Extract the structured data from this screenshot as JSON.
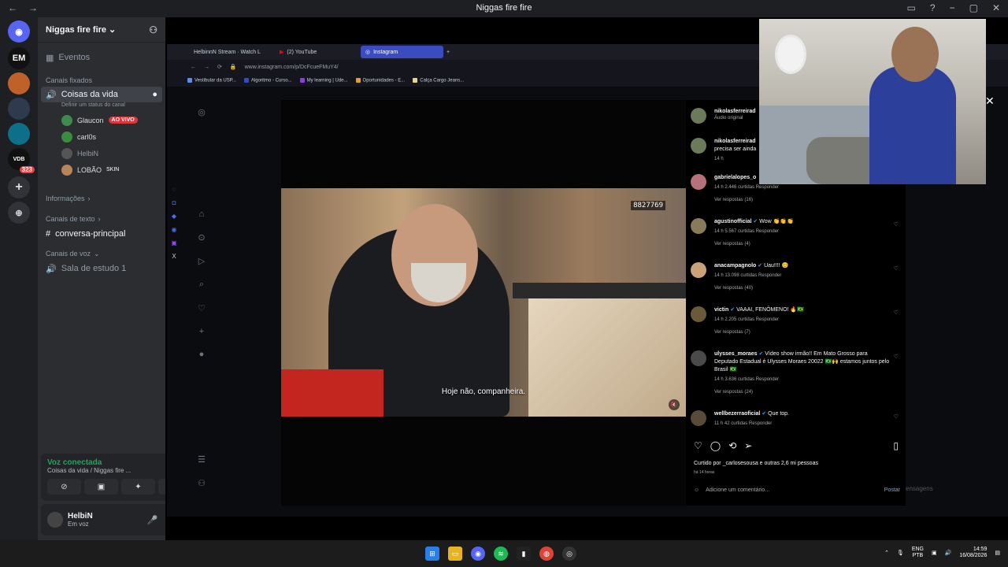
{
  "window": {
    "title": "Niggas fire fire",
    "controls": [
      "−",
      "▢",
      "✕"
    ]
  },
  "servers": [
    {
      "name": "discord-home",
      "label": ""
    },
    {
      "name": "server-em",
      "label": "EM"
    },
    {
      "name": "server-tiger",
      "label": ""
    },
    {
      "name": "server-selected",
      "label": ""
    },
    {
      "name": "server-blue",
      "label": ""
    },
    {
      "name": "server-vdb",
      "label": "VDB",
      "badge": "323"
    },
    {
      "name": "add-server",
      "label": "+"
    },
    {
      "name": "explore",
      "label": "⊕"
    }
  ],
  "guild": {
    "name": "Niggas fire fire",
    "events": "Eventos",
    "pinned_header": "Canais fixados",
    "voice_channel": "Coisas da vida",
    "set_status": "Definir um status do canal",
    "members": [
      {
        "name": "Glaucon",
        "live": "AO VIVO"
      },
      {
        "name": "carl0s",
        "live": ""
      },
      {
        "name": "HelbiN",
        "live": ""
      },
      {
        "name": "LOBÃO",
        "tag": "SKIN"
      }
    ],
    "info_header": "Informações",
    "text_header": "Canais de texto",
    "text_channel": "conversa-principal",
    "voice_header": "Canais de voz",
    "voice_room": "Sala de estudo 1"
  },
  "voice_panel": {
    "status": "Voz conectada",
    "location": "Coisas da vida / Niggas fire ..."
  },
  "user_panel": {
    "name": "HelbiN",
    "status": "Em voz"
  },
  "browser": {
    "tabs": [
      {
        "label": "HelbinnN Stream · Watch L",
        "active": false
      },
      {
        "label": "(2) YouTube",
        "active": false
      },
      {
        "label": "Instagram",
        "active": true
      }
    ],
    "url": "www.instagram.com/p/DcFcueFMuY4/",
    "bookmarks": [
      "Vestibular da USP...",
      "Algoritmo - Curso...",
      "My learning | Ude...",
      "Oportunidades - E...",
      "Calça Cargo Jeans..."
    ]
  },
  "video": {
    "hud": "8827769",
    "subtitle": "Hoje não, companheira."
  },
  "comments": [
    {
      "user": "nikolasferreirad",
      "text": "",
      "meta": "Áudio original",
      "replies": ""
    },
    {
      "user": "nikolasferreirad",
      "text": "precisa ser ainda",
      "meta": "14 h",
      "replies": ""
    },
    {
      "user": "gabrielalopes_o",
      "text": "",
      "meta": "14 h  2.446 curtidas  Responder",
      "replies": "Ver respostas (16)"
    },
    {
      "user": "agustinofficial",
      "text": "Wow 👏👏👏",
      "meta": "14 h  5.567 curtidas  Responder",
      "replies": "Ver respostas (4)"
    },
    {
      "user": "anacampagnolo",
      "text": "Uau!!!! 😊",
      "meta": "14 h  13.098 curtidas  Responder",
      "replies": "Ver respostas (40)"
    },
    {
      "user": "victin",
      "text": "VAAAI, FENÔMENO! 🔥🇧🇷",
      "meta": "14 h  2.205 curtidas  Responder",
      "replies": "Ver respostas (7)"
    },
    {
      "user": "ulysses_moraes",
      "text": "Vídeo show irmão!! Em Mato Grosso para Deputado Estadual é Ulysses Moraes 20022 🇧🇷🙌 estamos juntos pelo Brasil 🇧🇷",
      "meta": "14 h  3.636 curtidas  Responder",
      "replies": "Ver respostas (24)"
    },
    {
      "user": "wellbezerraoficial",
      "text": "Que top.",
      "meta": "11 h  42 curtidas  Responder",
      "replies": ""
    }
  ],
  "post": {
    "likes": "Curtido por _carlosesousa e outras 2,6 mi pessoas",
    "ago": "há 14 horas",
    "add_comment": "Adicione um comentário...",
    "post_button": "Postar",
    "messages": "ensagens"
  },
  "taskbar": {
    "lang_top": "ENG",
    "lang_bottom": "PTB",
    "time": "14:59",
    "date": "16/08/2026"
  },
  "colors": {
    "discord_bg": "#2b2d31",
    "accent_live": "#da373c",
    "voice_green": "#23a559",
    "ig_tab_active": "#3b4cc0"
  }
}
